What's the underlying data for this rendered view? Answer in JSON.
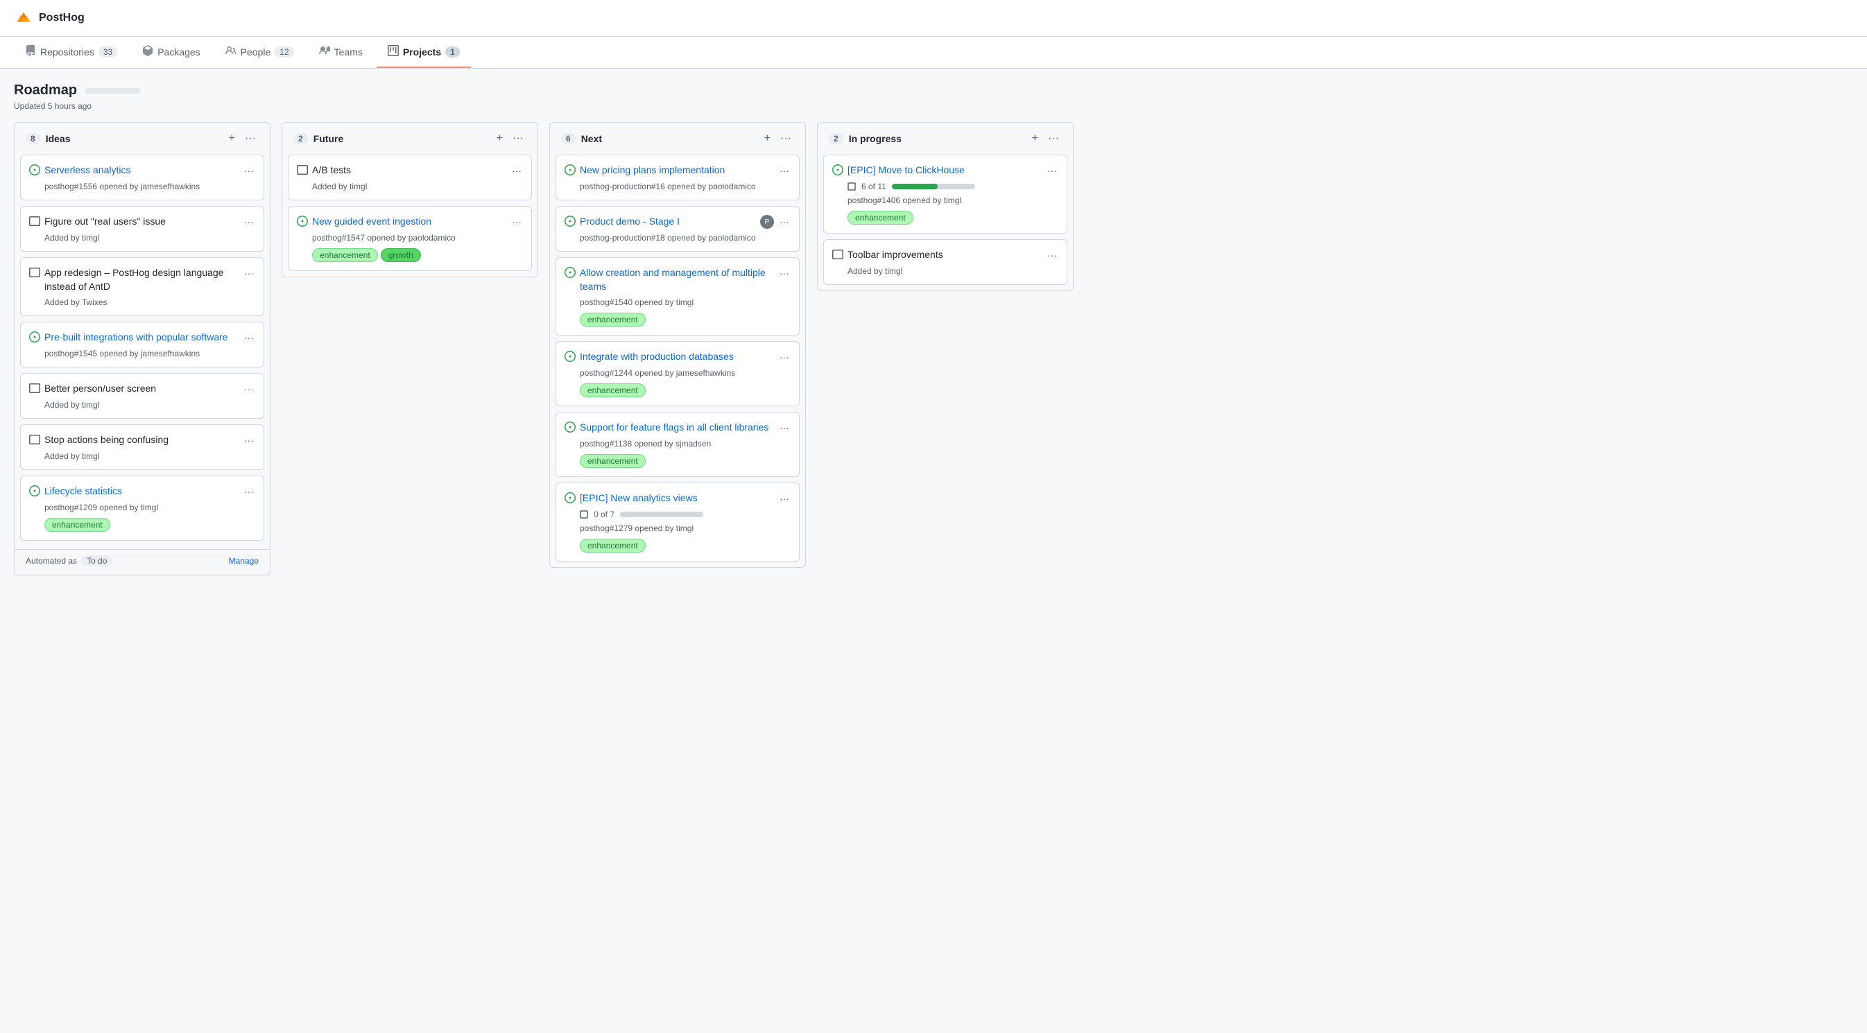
{
  "app": {
    "title": "PostHog"
  },
  "nav": {
    "tabs": [
      {
        "id": "repositories",
        "label": "Repositories",
        "count": "33",
        "active": false,
        "icon": "repo"
      },
      {
        "id": "packages",
        "label": "Packages",
        "count": null,
        "active": false,
        "icon": "package"
      },
      {
        "id": "people",
        "label": "People",
        "count": "12",
        "active": false,
        "icon": "people"
      },
      {
        "id": "teams",
        "label": "Teams",
        "count": null,
        "active": false,
        "icon": "teams"
      },
      {
        "id": "projects",
        "label": "Projects",
        "count": "1",
        "active": true,
        "icon": "projects"
      }
    ]
  },
  "page": {
    "title": "Roadmap",
    "subtitle": "Updated 5 hours ago"
  },
  "board": {
    "columns": [
      {
        "id": "ideas",
        "title": "Ideas",
        "count": "8",
        "cards": [
          {
            "id": "c1",
            "type": "issue",
            "title": "Serverless analytics",
            "meta": "posthog#1556 opened by jamesefhawkins",
            "tags": [],
            "progress": null,
            "avatar": false,
            "isLink": true
          },
          {
            "id": "c2",
            "type": "draft",
            "title": "Figure out \"real users\" issue",
            "meta": "Added by timgl",
            "tags": [],
            "progress": null,
            "avatar": false,
            "isLink": false
          },
          {
            "id": "c3",
            "type": "draft",
            "title": "App redesign – PostHog design language instead of AntD",
            "meta": "Added by Twixes",
            "tags": [],
            "progress": null,
            "avatar": false,
            "isLink": false
          },
          {
            "id": "c4",
            "type": "issue",
            "title": "Pre-built integrations with popular software",
            "meta": "posthog#1545 opened by jamesefhawkins",
            "tags": [],
            "progress": null,
            "avatar": false,
            "isLink": true
          },
          {
            "id": "c5",
            "type": "draft",
            "title": "Better person/user screen",
            "meta": "Added by timgl",
            "tags": [],
            "progress": null,
            "avatar": false,
            "isLink": false
          },
          {
            "id": "c6",
            "type": "draft",
            "title": "Stop actions being confusing",
            "meta": "Added by timgl",
            "tags": [],
            "progress": null,
            "avatar": false,
            "isLink": false
          },
          {
            "id": "c7",
            "type": "issue",
            "title": "Lifecycle statistics",
            "meta": "posthog#1209 opened by timgl",
            "tags": [
              "enhancement"
            ],
            "progress": null,
            "avatar": false,
            "isLink": true
          }
        ],
        "footer": {
          "label": "Automated as",
          "badge": "To do",
          "action": "Manage"
        }
      },
      {
        "id": "future",
        "title": "Future",
        "count": "2",
        "cards": [
          {
            "id": "f1",
            "type": "draft",
            "title": "A/B tests",
            "meta": "Added by timgl",
            "tags": [],
            "progress": null,
            "avatar": false,
            "isLink": false
          },
          {
            "id": "f2",
            "type": "issue",
            "title": "New guided event ingestion",
            "meta": "posthog#1547 opened by paolodamico",
            "tags": [
              "enhancement",
              "growth"
            ],
            "progress": null,
            "avatar": false,
            "isLink": true
          }
        ],
        "footer": null
      },
      {
        "id": "next",
        "title": "Next",
        "count": "6",
        "cards": [
          {
            "id": "n1",
            "type": "issue",
            "title": "New pricing plans implementation",
            "meta": "posthog-production#16 opened by paolodamico",
            "tags": [],
            "progress": null,
            "avatar": false,
            "isLink": true
          },
          {
            "id": "n2",
            "type": "issue",
            "title": "Product demo - Stage I",
            "meta": "posthog-production#18 opened by paolodamico",
            "tags": [],
            "progress": null,
            "avatar": true,
            "isLink": true
          },
          {
            "id": "n3",
            "type": "issue",
            "title": "Allow creation and management of multiple teams",
            "meta": "posthog#1540 opened by timgl",
            "tags": [
              "enhancement"
            ],
            "progress": null,
            "avatar": false,
            "isLink": true
          },
          {
            "id": "n4",
            "type": "issue",
            "title": "Integrate with production databases",
            "meta": "posthog#1244 opened by jamesefhawkins",
            "tags": [
              "enhancement"
            ],
            "progress": null,
            "avatar": false,
            "isLink": true
          },
          {
            "id": "n5",
            "type": "issue",
            "title": "Support for feature flags in all client libraries",
            "meta": "posthog#1138 opened by sjmadsen",
            "tags": [
              "enhancement"
            ],
            "progress": null,
            "avatar": false,
            "isLink": true
          },
          {
            "id": "n6",
            "type": "issue",
            "title": "[EPIC] New analytics views",
            "meta": "posthog#1279 opened by timgl",
            "tags": [
              "enhancement"
            ],
            "progress": {
              "current": 0,
              "total": 7,
              "percent": 0
            },
            "avatar": false,
            "isLink": true
          }
        ],
        "footer": null
      },
      {
        "id": "in-progress",
        "title": "In progress",
        "count": "2",
        "cards": [
          {
            "id": "ip1",
            "type": "issue",
            "title": "[EPIC] Move to ClickHouse",
            "meta": "posthog#1406 opened by timgl",
            "tags": [
              "enhancement"
            ],
            "progress": {
              "current": 6,
              "total": 11,
              "percent": 55
            },
            "avatar": false,
            "isLink": true
          },
          {
            "id": "ip2",
            "type": "draft",
            "title": "Toolbar improvements",
            "meta": "Added by timgl",
            "tags": [],
            "progress": null,
            "avatar": false,
            "isLink": false
          }
        ],
        "footer": null
      }
    ]
  },
  "icons": {
    "ellipsis": "···",
    "plus": "+",
    "manage": "Manage"
  }
}
